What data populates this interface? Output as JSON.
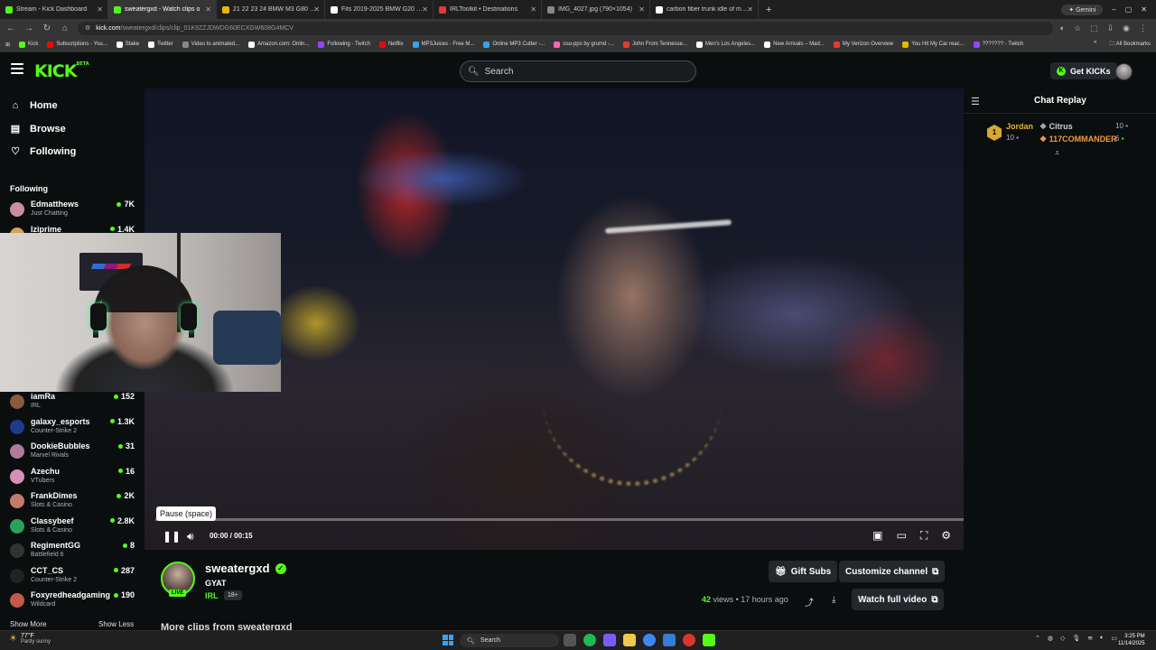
{
  "browser": {
    "tabs": [
      {
        "title": "Stream - Kick Dashboard",
        "color": "#53fc18",
        "active": false
      },
      {
        "title": "sweatergxd - Watch clips o",
        "color": "#53fc18",
        "active": true
      },
      {
        "title": "21 22 23 24 BMW M3 G80 Rea",
        "color": "#e6b800",
        "active": false
      },
      {
        "title": "Fits 2019-2025 BMW G20 330i",
        "color": "#ffffff",
        "active": false
      },
      {
        "title": "IRLToolkit • Destinations",
        "color": "#e53935",
        "active": false
      },
      {
        "title": "IMG_4027.jpg (790×1054)",
        "color": "#888888",
        "active": false
      },
      {
        "title": "carbon fiber trunk idle of man g",
        "color": "#ffffff",
        "active": false
      }
    ],
    "gemini_label": "Gemini",
    "url_host": "kick.com",
    "url_path": "/sweatergxd/clips/clip_01K9ZZJDWDG60ECXGW608G4MCV",
    "bookmarks": [
      {
        "label": "Kick",
        "color": "#53fc18"
      },
      {
        "label": "Subscriptions - You...",
        "color": "#ff0000"
      },
      {
        "label": "Stake",
        "color": "#ffffff"
      },
      {
        "label": "Twitter",
        "color": "#ffffff"
      },
      {
        "label": "Video to animated...",
        "color": "#888888"
      },
      {
        "label": "Amazon.com: Onlin...",
        "color": "#ffffff"
      },
      {
        "label": "Following - Twitch",
        "color": "#9146ff"
      },
      {
        "label": "Netflix",
        "color": "#e50914"
      },
      {
        "label": "MP3Juices - Free M...",
        "color": "#3aa0f0"
      },
      {
        "label": "Online MP3 Cutter -...",
        "color": "#3aa0f0"
      },
      {
        "label": "osu-pps by grumd -...",
        "color": "#ff66aa"
      },
      {
        "label": "John From Tennesse...",
        "color": "#e53935"
      },
      {
        "label": "Men's Los Angeles...",
        "color": "#ffffff"
      },
      {
        "label": "New Arrivals – Mad...",
        "color": "#ffffff"
      },
      {
        "label": "My Verizon Overview",
        "color": "#e53935"
      },
      {
        "label": "You Hit My Car reac...",
        "color": "#e6b800"
      },
      {
        "label": "??????? - Twitch",
        "color": "#9146ff"
      }
    ],
    "all_bookmarks": "All Bookmarks"
  },
  "kick": {
    "logo": "KICK",
    "logo_tag": "BETA",
    "search_placeholder": "Search",
    "get_kicks": "Get KICKs"
  },
  "sidebar": {
    "nav": [
      {
        "label": "Home",
        "icon": "home-icon"
      },
      {
        "label": "Browse",
        "icon": "browse-icon"
      },
      {
        "label": "Following",
        "icon": "heart-icon"
      }
    ],
    "following_heading": "Following",
    "channels_top": [
      {
        "name": "Edmatthews",
        "category": "Just Chatting",
        "viewers": "7K",
        "color": "#c98fa0"
      },
      {
        "name": "Iziprime",
        "category": "",
        "viewers": "1.4K",
        "color": "#d2a25a"
      }
    ],
    "channels": [
      {
        "name": "iamRa",
        "category": "IRL",
        "viewers": "152",
        "color": "#8a5a3c"
      },
      {
        "name": "galaxy_esports",
        "category": "Counter-Strike 2",
        "viewers": "1.3K",
        "color": "#1e3a8a"
      },
      {
        "name": "DookieBubbles",
        "category": "Marvel Rivals",
        "viewers": "31",
        "color": "#b07a9a"
      },
      {
        "name": "Azechu",
        "category": "VTubers",
        "viewers": "16",
        "color": "#d98fb5"
      },
      {
        "name": "FrankDimes",
        "category": "Slots & Casino",
        "viewers": "2K",
        "color": "#c47a6a"
      },
      {
        "name": "Classybeef",
        "category": "Slots & Casino",
        "viewers": "2.8K",
        "color": "#2aa05a"
      },
      {
        "name": "RegimentGG",
        "category": "Battlefield 6",
        "viewers": "8",
        "color": "#333333"
      },
      {
        "name": "CCT_CS",
        "category": "Counter-Strike 2",
        "viewers": "287",
        "color": "#222222"
      },
      {
        "name": "Foxyredheadgaming",
        "category": "Wildcard",
        "viewers": "190",
        "color": "#c25a4a"
      }
    ],
    "show_more": "Show More",
    "show_less": "Show Less"
  },
  "player": {
    "tooltip": "Pause (space)",
    "time": "00:00 / 00:15",
    "progress": 0.0
  },
  "chat": {
    "title": "Chat Replay",
    "leaderboard": [
      {
        "rank": "1",
        "name": "Jordan",
        "count": "10"
      },
      {
        "name": "Citrus",
        "count": "10"
      },
      {
        "name": "117COMMANDER",
        "count": "6"
      }
    ]
  },
  "clip": {
    "channel": "sweatergxd",
    "live": "LIVE",
    "title": "GYAT",
    "category": "IRL",
    "age_rating": "18+",
    "gift_subs": "Gift Subs",
    "customize": "Customize channel",
    "views": "42",
    "views_label": "views",
    "time_ago": "• 17 hours ago",
    "watch_full": "Watch full video",
    "more_clips": "More clips from sweatergxd"
  },
  "taskbar": {
    "temp": "77°F",
    "weather": "Partly sunny",
    "search": "Search",
    "time": "3:25 PM",
    "date": "11/14/2025"
  }
}
